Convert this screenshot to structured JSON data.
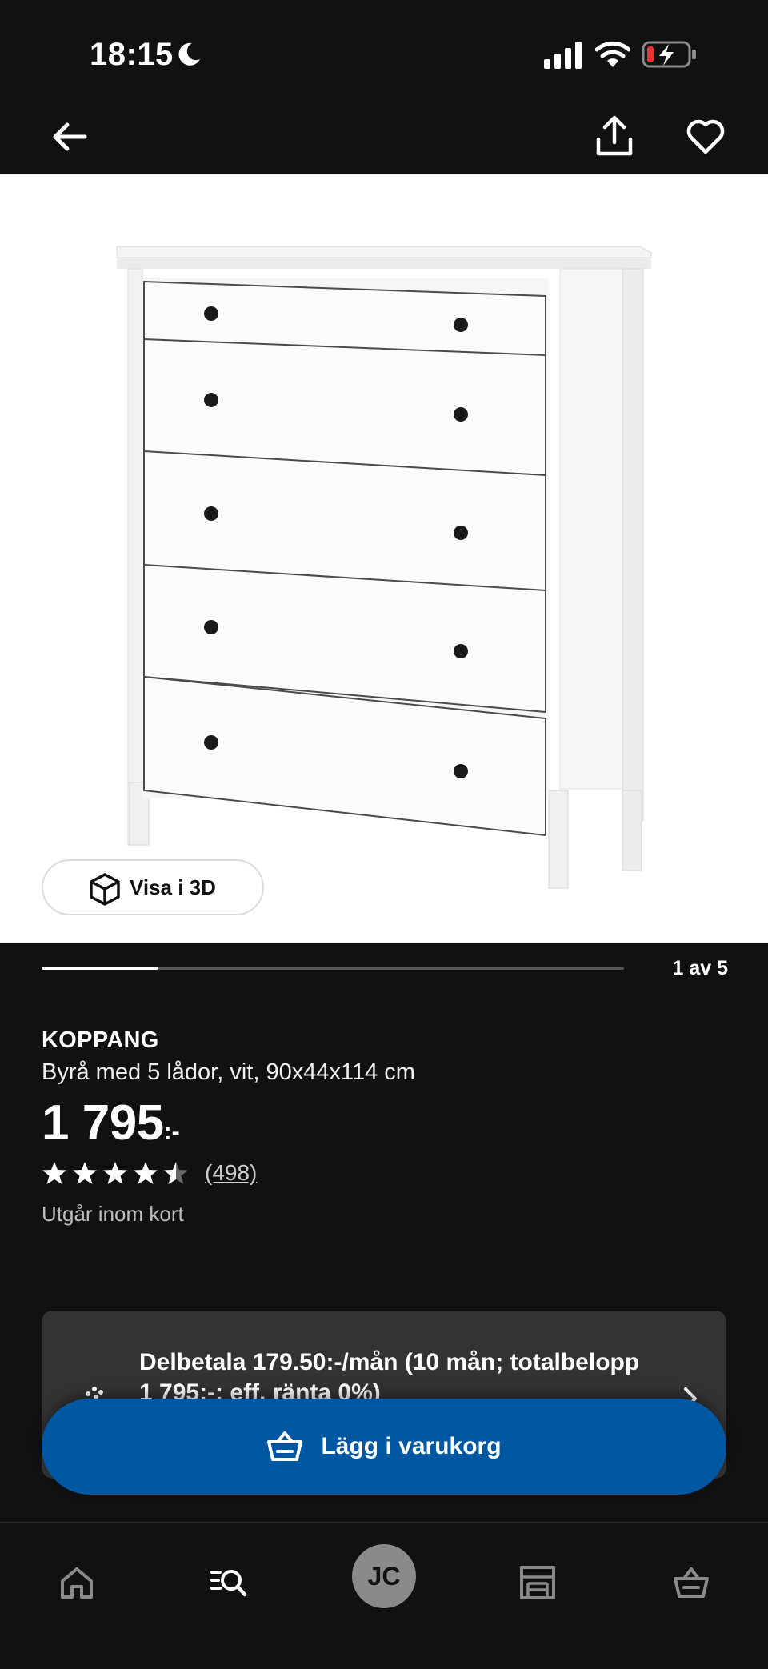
{
  "status_bar": {
    "time": "18:15",
    "icons": [
      "moon-icon",
      "cellular-signal-icon",
      "wifi-icon",
      "battery-charging-icon"
    ]
  },
  "nav": {
    "back_icon": "arrow-left-icon",
    "share_icon": "share-icon",
    "favorite_icon": "heart-icon"
  },
  "gallery": {
    "view_3d_label": "Visa i 3D",
    "counter": "1 av 5",
    "progress": 0.2
  },
  "product": {
    "name": "KOPPANG",
    "description": "Byrå med 5 lådor, vit, 90x44x114 cm",
    "price_main": "1 795",
    "price_suffix": ":-",
    "rating": 4.5,
    "review_count": "(498)",
    "availability": "Utgår inom kort"
  },
  "installment": {
    "text": "Delbetala 179.50:-/mån (10 mån; totalbelopp 1 795:-; eff. ränta 0%)",
    "icon": "payment-icon"
  },
  "cart_button": {
    "label": "Lägg i varukorg",
    "icon": "shopping-basket-icon"
  },
  "tab_bar": {
    "tabs": [
      {
        "name": "home",
        "icon": "home-icon"
      },
      {
        "name": "search",
        "icon": "search-list-icon"
      },
      {
        "name": "profile",
        "initials": "JC"
      },
      {
        "name": "stores",
        "icon": "store-icon"
      },
      {
        "name": "cart",
        "icon": "basket-icon"
      }
    ]
  },
  "colors": {
    "background": "#111111",
    "card": "#333333",
    "primary_button": "#0058a3",
    "text": "#ffffff",
    "muted_text": "#bdbdbd"
  }
}
